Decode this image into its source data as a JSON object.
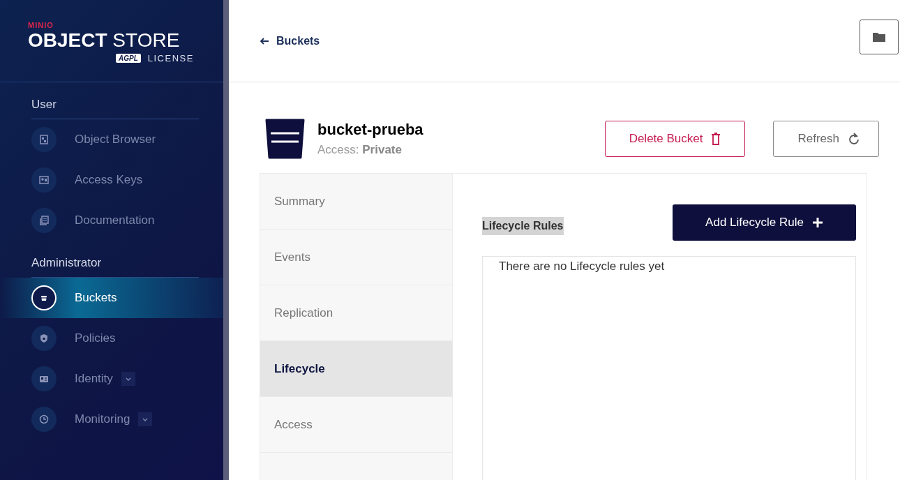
{
  "logo": {
    "brand": "MINIO",
    "product_bold": "OBJECT",
    "product_light": "STORE",
    "badge": "AGPL",
    "license": "LICENSE"
  },
  "sidebar": {
    "sections": [
      {
        "title": "User",
        "items": [
          {
            "label": "Object Browser",
            "selected": false,
            "has_submenu": false
          },
          {
            "label": "Access Keys",
            "selected": false,
            "has_submenu": false
          },
          {
            "label": "Documentation",
            "selected": false,
            "has_submenu": false
          }
        ]
      },
      {
        "title": "Administrator",
        "items": [
          {
            "label": "Buckets",
            "selected": true,
            "has_submenu": false
          },
          {
            "label": "Policies",
            "selected": false,
            "has_submenu": false
          },
          {
            "label": "Identity",
            "selected": false,
            "has_submenu": true
          },
          {
            "label": "Monitoring",
            "selected": false,
            "has_submenu": true
          }
        ]
      }
    ]
  },
  "breadcrumb": {
    "back_label": "Buckets"
  },
  "bucket": {
    "name": "bucket-prueba",
    "access_label": "Access:",
    "access_value": "Private"
  },
  "actions": [
    {
      "label": "Delete Bucket",
      "kind": "danger"
    },
    {
      "label": "Refresh",
      "kind": "outline"
    }
  ],
  "tabs": [
    {
      "label": "Summary",
      "selected": false
    },
    {
      "label": "Events",
      "selected": false
    },
    {
      "label": "Replication",
      "selected": false
    },
    {
      "label": "Lifecycle",
      "selected": true
    },
    {
      "label": "Access",
      "selected": false
    }
  ],
  "lifecycle": {
    "title": "Lifecycle Rules",
    "add_button": "Add Lifecycle Rule",
    "empty_text": "There are no Lifecycle rules yet"
  }
}
